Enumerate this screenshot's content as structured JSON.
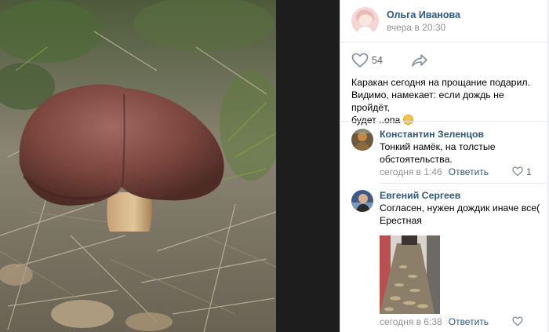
{
  "post": {
    "author_name": "Ольга Иванова",
    "time": "вчера в 20:30",
    "likes": "54",
    "text_line1": "Каракан сегодня на прощание подарил.",
    "text_line2": "Видимо, намекает: если дождь не пройдёт,",
    "text_line3": "будет ..опа"
  },
  "comments": [
    {
      "name": "Константин Зеленцов",
      "text_line1": "Тонкий намёк, на толстые",
      "text_line2": "обстоятельства.",
      "time": "сегодня в 1:46",
      "reply_label": "Ответить",
      "likes": "1"
    },
    {
      "name": "Евгений Сергеев",
      "text_line1": "Согласен, нужен дождик иначе все(",
      "text_line2": "Ерестная",
      "time": "сегодня в 6:38",
      "reply_label": "Ответить"
    }
  ],
  "icons": {
    "like": "heart-icon",
    "share": "share-arrow-icon",
    "emoji": "laughing-emoji"
  },
  "colors": {
    "link": "#2a5885",
    "meta": "#939393",
    "background_dark": "#1d1d1d"
  }
}
